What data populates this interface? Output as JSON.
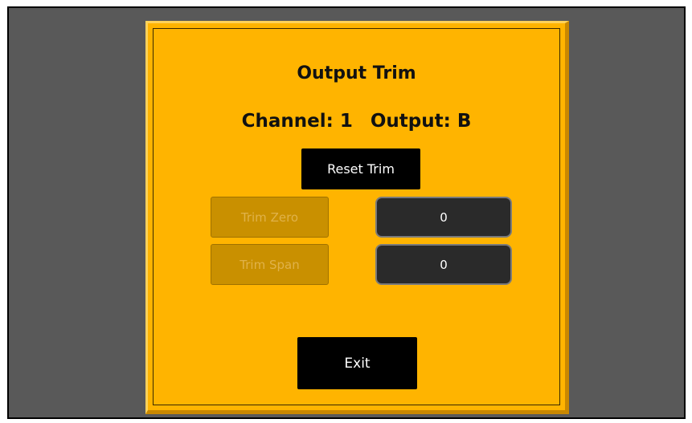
{
  "dialog": {
    "title": "Output Trim",
    "channel_label": "Channel: 1",
    "output_label": "Output: B",
    "reset_button": "Reset Trim",
    "trim_zero": {
      "label": "Trim Zero",
      "value": "0"
    },
    "trim_span": {
      "label": "Trim Span",
      "value": "0"
    },
    "exit_button": "Exit"
  },
  "colors": {
    "background": "#595959",
    "dialog": "#ffb400",
    "button": "#000000",
    "field": "#2a2a2a"
  }
}
